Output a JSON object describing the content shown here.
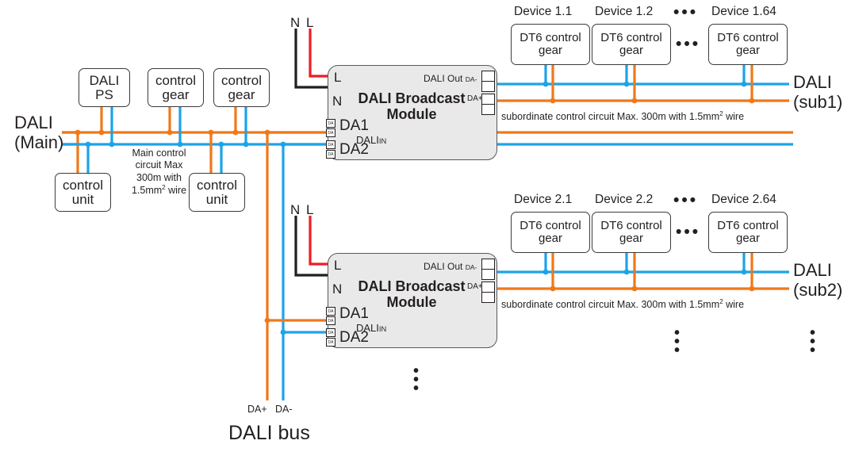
{
  "diagram": {
    "title": "DALI Broadcast Module system wiring diagram",
    "colors": {
      "dali_plus_orange": "#F07818",
      "dali_minus_blue": "#1CA3E8",
      "live_red": "#ED1C24",
      "neutral_black": "#231F20",
      "module_fill": "#E9E9E9"
    }
  },
  "main_bus": {
    "label_line1": "DALI",
    "label_line2": "(Main)",
    "note_line1": "Main control",
    "note_line2": "circuit Max",
    "note_line3": "300m with",
    "note_line4_pre": "1.5mm",
    "note_line4_sup": "2",
    "note_line4_post": " wire"
  },
  "main_devices": {
    "top": [
      {
        "line1": "DALI",
        "line2": "PS"
      },
      {
        "line1": "control",
        "line2": "gear"
      },
      {
        "line1": "control",
        "line2": "gear"
      }
    ],
    "bottom": [
      {
        "line1": "control",
        "line2": "unit"
      },
      {
        "line1": "control",
        "line2": "unit"
      }
    ]
  },
  "modules": [
    {
      "title_line1": "DALI Broadcast",
      "title_line2": "Module",
      "mains": {
        "n": "N",
        "l": "L",
        "n_label": "N",
        "l_label": "L"
      },
      "dali_in_label": "DALI",
      "dali_in_small": "IN",
      "in_terminals": [
        "DA1",
        "DA2"
      ],
      "terminal_tag": "DA",
      "dali_out_label": "DALI Out",
      "out_terminals": [
        "DA-",
        "DA+"
      ]
    },
    {
      "title_line1": "DALI Broadcast",
      "title_line2": "Module",
      "mains": {
        "n": "N",
        "l": "L",
        "n_label": "N",
        "l_label": "L"
      },
      "dali_in_label": "DALI",
      "dali_in_small": "IN",
      "in_terminals": [
        "DA1",
        "DA2"
      ],
      "terminal_tag": "DA",
      "dali_out_label": "DALI Out",
      "out_terminals": [
        "DA-",
        "DA+"
      ]
    }
  ],
  "sub_buses": [
    {
      "bus_label_line1": "DALI",
      "bus_label_line2": "(sub1)",
      "note_pre": "subordinate control circuit Max. 300m with 1.5mm",
      "note_sup": "2",
      "note_post": " wire",
      "device_labels": [
        "Device 1.1",
        "Device 1.2",
        "Device 1.64"
      ],
      "ellipsis": "•••",
      "gear_line1": "DT6 control",
      "gear_line2": "gear"
    },
    {
      "bus_label_line1": "DALI",
      "bus_label_line2": "(sub2)",
      "note_pre": "subordinate control circuit Max. 300m with 1.5mm",
      "note_sup": "2",
      "note_post": " wire",
      "device_labels": [
        "Device 2.1",
        "Device 2.2",
        "Device 2.64"
      ],
      "ellipsis": "•••",
      "gear_line1": "DT6 control",
      "gear_line2": "gear"
    }
  ],
  "bus_footer": {
    "da_plus": "DA+",
    "da_minus": "DA-",
    "title": "DALI bus"
  },
  "vertical_ellipsis": "•\n•\n•"
}
